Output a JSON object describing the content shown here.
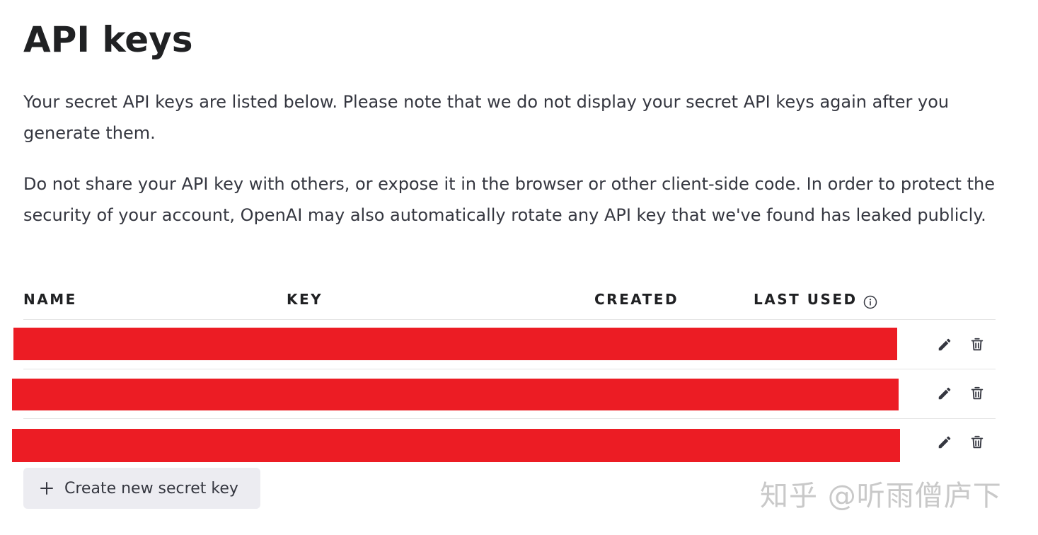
{
  "page": {
    "title": "API keys",
    "description_1": "Your secret API keys are listed below. Please note that we do not display your secret API keys again after you generate them.",
    "description_2": "Do not share your API key with others, or expose it in the browser or other client-side code. In order to protect the security of your account, OpenAI may also automatically rotate any API key that we've found has leaked publicly."
  },
  "table": {
    "columns": {
      "name": "NAME",
      "key": "KEY",
      "created": "CREATED",
      "last_used": "LAST USED"
    },
    "rows": [
      {
        "redacted": true,
        "actions": [
          "edit-icon",
          "trash-icon"
        ]
      },
      {
        "redacted": true,
        "actions": [
          "edit-icon",
          "trash-icon"
        ]
      },
      {
        "redacted": true,
        "actions": [
          "edit-icon",
          "trash-icon"
        ]
      }
    ]
  },
  "actions": {
    "create_label": "Create new secret key",
    "create_icon": "plus-icon"
  },
  "watermark": "知乎 @听雨僧庐下",
  "colors": {
    "redaction": "#ec1c24",
    "button_bg": "#ececf1",
    "divider": "#e5e5e5"
  }
}
